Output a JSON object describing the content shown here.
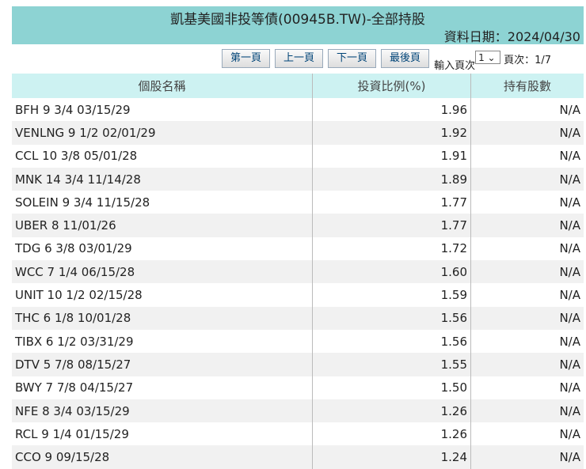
{
  "header": {
    "title": "凱基美國非投等債(00945B.TW)-全部持股",
    "date": "資料日期：2024/04/30"
  },
  "pager": {
    "first": "第一頁",
    "prev": "上一頁",
    "next": "下一頁",
    "last": "最後頁",
    "input_label": "輸入頁次",
    "selected_page": "1",
    "page_info": "頁次：1/7"
  },
  "table": {
    "columns": [
      "個股名稱",
      "投資比例(%)",
      "持有股數"
    ],
    "rows": [
      [
        "BFH 9 3/4 03/15/29",
        "1.96",
        "N/A"
      ],
      [
        "VENLNG 9 1/2 02/01/29",
        "1.92",
        "N/A"
      ],
      [
        "CCL 10 3/8 05/01/28",
        "1.91",
        "N/A"
      ],
      [
        "MNK 14 3/4 11/14/28",
        "1.89",
        "N/A"
      ],
      [
        "SOLEIN 9 3/4 11/15/28",
        "1.77",
        "N/A"
      ],
      [
        "UBER 8 11/01/26",
        "1.77",
        "N/A"
      ],
      [
        "TDG 6 3/8 03/01/29",
        "1.72",
        "N/A"
      ],
      [
        "WCC 7 1/4 06/15/28",
        "1.60",
        "N/A"
      ],
      [
        "UNIT 10 1/2 02/15/28",
        "1.59",
        "N/A"
      ],
      [
        "THC 6 1/8 10/01/28",
        "1.56",
        "N/A"
      ],
      [
        "TIBX 6 1/2 03/31/29",
        "1.56",
        "N/A"
      ],
      [
        "DTV 5 7/8 08/15/27",
        "1.55",
        "N/A"
      ],
      [
        "BWY 7 7/8 04/15/27",
        "1.50",
        "N/A"
      ],
      [
        "NFE 8 3/4 03/15/29",
        "1.26",
        "N/A"
      ],
      [
        "RCL 9 1/4 01/15/29",
        "1.26",
        "N/A"
      ],
      [
        "CCO 9 09/15/28",
        "1.24",
        "N/A"
      ]
    ]
  }
}
